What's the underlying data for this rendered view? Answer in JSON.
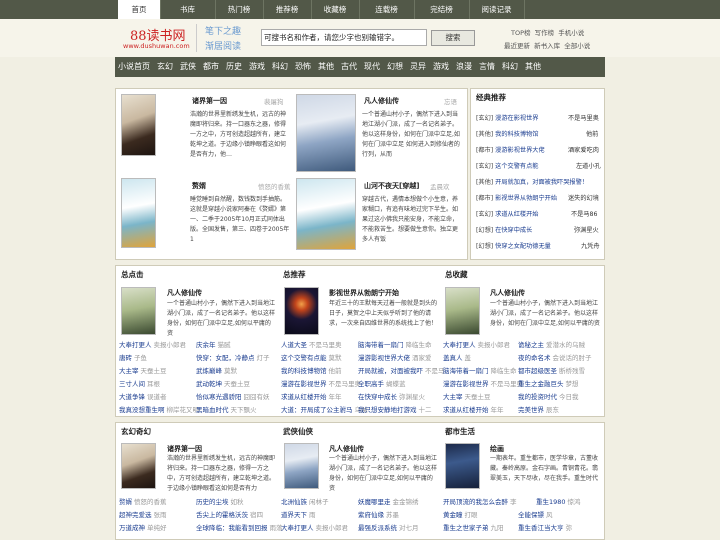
{
  "top_nav": [
    "首页",
    "书库",
    "热门榜",
    "推荐榜",
    "收藏榜",
    "连载榜",
    "完结榜",
    "阅读记录"
  ],
  "logo": {
    "name": "88读书网",
    "url": "www.dushuwan.com"
  },
  "slogan": [
    "笔下之趣",
    "渐居阅读"
  ],
  "search": {
    "value": "可搜书名和作者，请您少字也别输错字。",
    "button": "搜索"
  },
  "header_links": [
    [
      "TOP榜",
      "写作榜",
      "手机小说"
    ],
    [
      "最近更新",
      "新书入库",
      "全部小说"
    ]
  ],
  "categories": [
    "小说首页",
    "玄幻",
    "武侠",
    "都市",
    "历史",
    "游戏",
    "科幻",
    "恐怖",
    "其他",
    "古代",
    "现代",
    "幻想",
    "灵异",
    "游戏",
    "浪漫",
    "言情",
    "科幻",
    "其他"
  ],
  "featured": [
    {
      "title": "诸界第一因",
      "author": "裴屠狗",
      "desc": "浩瀚的世界里新绣发生机，远古的神魔即将归来。持一口器东之器，修得一方之中，方可创造超越所有，建立乾坤之道。于边缘小镇睁眼看这如何是否有力，他…"
    },
    {
      "title": "凡人修仙传",
      "author": "忘语",
      "desc": "一个普通山村小子，偶然下进入到当地江湖小门派，成了一名记名弟子。他以这样身份，如何在门派中立足,如何在门派中立足 如何进入到修仙者的行列，从而"
    },
    {
      "title": "赘婿",
      "author": "愤怒的香蕉",
      "desc": "睡觉睡到自然醒，数钱数到手抽筋。这就是穿越小说家阿秦在《赘婿》第一、二季于2005年10月正式同体出版。全国发售，第三、四卷于2005年1"
    },
    {
      "title": "山河不夜天[穿越]",
      "author": "孟晨欢",
      "desc": "穿越古代，遇情本想做个小生意，养家糊口，有追有味地过完下半生。如果过这小佛我只能安身，不能立命，不能救苦生。想要做生意你。独立更多人有饭"
    }
  ],
  "classic": {
    "title": "经典推荐",
    "rows": [
      {
        "cls": "[玄幻]",
        "title": "漫游在影视世界",
        "author": "不是马里奥"
      },
      {
        "cls": "[其他]",
        "title": "我的科技博物馆",
        "author": "他前"
      },
      {
        "cls": "[都市]",
        "title": "漫游影视世界大佬",
        "author": "酒家爱吃肉"
      },
      {
        "cls": "[玄幻]",
        "title": "这个交警有点能",
        "author": "左道小孔"
      },
      {
        "cls": "[其他]",
        "title": "开局就加真，对面被我吓哭报警！",
        "author": ""
      },
      {
        "cls": "[都市]",
        "title": "影视世界从勃朗宁开始",
        "author": "迷失的幻境"
      },
      {
        "cls": "[玄幻]",
        "title": "求道从红楼开始",
        "author": "不是马86"
      },
      {
        "cls": "[幻想]",
        "title": "在快穿中成长",
        "author": "弥渊星火"
      },
      {
        "cls": "[幻想]",
        "title": "快穿之女配功德无量",
        "author": "九凭舟"
      }
    ]
  },
  "rank_sections": [
    {
      "title": "总点击",
      "book": {
        "title": "凡人修仙传",
        "desc": "一个普通山村小子，偶然下进入到当地江湖小门派，成了一名记名弟子。他以这样身份，如何在门派中立足,如何以平庸的资"
      },
      "links": [
        [
          "大奉打更人",
          "卖报小郎君"
        ],
        [
          "庆余年",
          "猫腻"
        ],
        [
          "唐砖",
          "子鱼"
        ],
        [
          "快穿：女配，冷静点",
          "灯子"
        ],
        [
          "大主宰",
          "天蚕土豆"
        ],
        [
          "武炼巅峰",
          "莫默"
        ],
        [
          "三寸人间",
          "耳根"
        ],
        [
          "武动乾坤",
          "天蚕土豆"
        ],
        [
          "大道争锋",
          "误道者"
        ],
        [
          "恰似寒光遇骄阳",
          "囧囧有妖"
        ],
        [
          "我真没想重生啊",
          "柳岸花又明"
        ],
        [
          "黑暗血时代",
          "天下飘火"
        ]
      ]
    },
    {
      "title": "总推荐",
      "book": {
        "title": "影视世界从勃朗宁开始",
        "desc": "年近三十的王默每天过着一般就是到头的日子，莫贺之中上天似乎听到了他的请求，一次来自四维世界的系统找上了他！"
      },
      "links": [
        [
          "人道大圣",
          "不是马里奥"
        ],
        [
          "脑海带着一扇门",
          "降临生命"
        ],
        [
          "这个交警有点能",
          "莫默"
        ],
        [
          "漫游影视世界大佬",
          "酒家爱"
        ],
        [
          "我的科技博物馆",
          "他前"
        ],
        [
          "开局就被，对面被我吓",
          "不是马"
        ],
        [
          "漫游在影视世界",
          "不是马里奥"
        ],
        [
          "全职高手",
          "蝴蝶蓝"
        ],
        [
          "求道从红楼开始",
          "年年"
        ],
        [
          "在快穿中成长",
          "弥渊星火"
        ],
        [
          "大道：开局成了公主驸马",
          "乌贼"
        ],
        [
          "我只想安静地打游戏",
          "十二"
        ]
      ]
    },
    {
      "title": "总收藏",
      "book": {
        "title": "凡人修仙传",
        "desc": "一个普通山村小子，偶然下进入到当地江湖小门派，成了一名记名弟子。他以这样身份，如何在门派中立足,如何以平庸的资"
      },
      "links": [
        [
          "大奉打更人",
          "卖报小郎君"
        ],
        [
          "诡秘之主",
          "爱潜水的乌贼"
        ],
        [
          "盖真人",
          "盖"
        ],
        [
          "夜的命名术",
          "会说话的肘子"
        ],
        [
          "脑海带着一扇门",
          "降临生命"
        ],
        [
          "都市超级医圣",
          "断桥残雪"
        ],
        [
          "漫游在影视世界",
          "不是马里奥"
        ],
        [
          "重生之金融巨头",
          "梦想"
        ],
        [
          "大主宰",
          "天蚕土豆"
        ],
        [
          "我的投资时代",
          "今日我"
        ],
        [
          "求道从红楼开始",
          "年年"
        ],
        [
          "完美世界",
          "辰东"
        ]
      ]
    }
  ],
  "genre_sections": [
    {
      "title": "玄幻奇幻",
      "book": {
        "title": "诸界第一因",
        "desc": "浩瀚的世界里新绣发生机，远古的神魔即将归来。持一口器东之器，修得一方之中，方可创造超越所有，建立乾坤之道。于边缘小镇睁眼看这如何是否有力"
      },
      "links": [
        [
          "赘婿",
          "愤怒的香蕉"
        ],
        [
          "历史的尘埃",
          "如秋"
        ],
        [
          "超神完爱选",
          "张雨"
        ],
        [
          "舌尖上的霍格沃茨",
          "宿四"
        ],
        [
          "万道成神",
          "单纯好"
        ],
        [
          "全球降临：我能看到回报",
          "雨落"
        ]
      ]
    },
    {
      "title": "武侠仙侠",
      "book": {
        "title": "凡人修仙传",
        "desc": "一个普通山村小子，偶然下进入到当地江湖小门派，成了一名记名弟子。他以这样身份，如何在门派中立足,如何以平庸的资"
      },
      "links": [
        [
          "北洲仙族",
          "闲林子"
        ],
        [
          "妖魔哪里走",
          "金金锦绣"
        ],
        [
          "道界天下",
          "雨"
        ],
        [
          "紫府仙缘",
          "苏墨"
        ],
        [
          "大奉打更人",
          "卖报小郎君"
        ],
        [
          "最强反派系统",
          "对七月"
        ]
      ]
    },
    {
      "title": "都市生活",
      "book": {
        "title": "绘画",
        "desc": "一期表年。重生都市，医学华章，古董收藏。秦岭高原。金石字画。青铜青花。翡翠美玉，天下尽收，尽在我手。重生时代"
      },
      "links": [
        [
          "开局顶流的我怎么会醉",
          "李"
        ],
        [
          "重生1980",
          "惊鸿"
        ],
        [
          "黄金瞳",
          "打眼"
        ],
        [
          "全能保镖",
          "风"
        ],
        [
          "重生之世家子弟",
          "九阳"
        ],
        [
          "重生香江当大亨",
          "弥"
        ]
      ]
    }
  ],
  "colors": {
    "nav_bg": "#525848",
    "page_bg": "#f1efe3",
    "link": "#1a3c8f",
    "red": "#cc2222"
  }
}
